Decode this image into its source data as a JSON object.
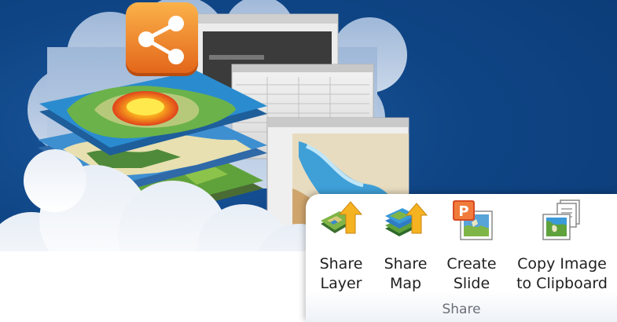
{
  "ribbon": {
    "group_label": "Share",
    "buttons": [
      {
        "id": "share-layer",
        "label": "Share\nLayer",
        "icon": "share-layer-icon"
      },
      {
        "id": "share-map",
        "label": "Share\nMap",
        "icon": "share-map-icon"
      },
      {
        "id": "create-slide",
        "label": "Create\nSlide",
        "icon": "powerpoint-slide-icon"
      },
      {
        "id": "copy-image",
        "label": "Copy Image\nto Clipboard",
        "icon": "copy-image-clipboard-icon"
      }
    ],
    "slide_icon_letter": "P"
  },
  "colors": {
    "background": "#0f4585",
    "share_badge": "#f0821e",
    "ribbon_panel": "#ffffff"
  }
}
